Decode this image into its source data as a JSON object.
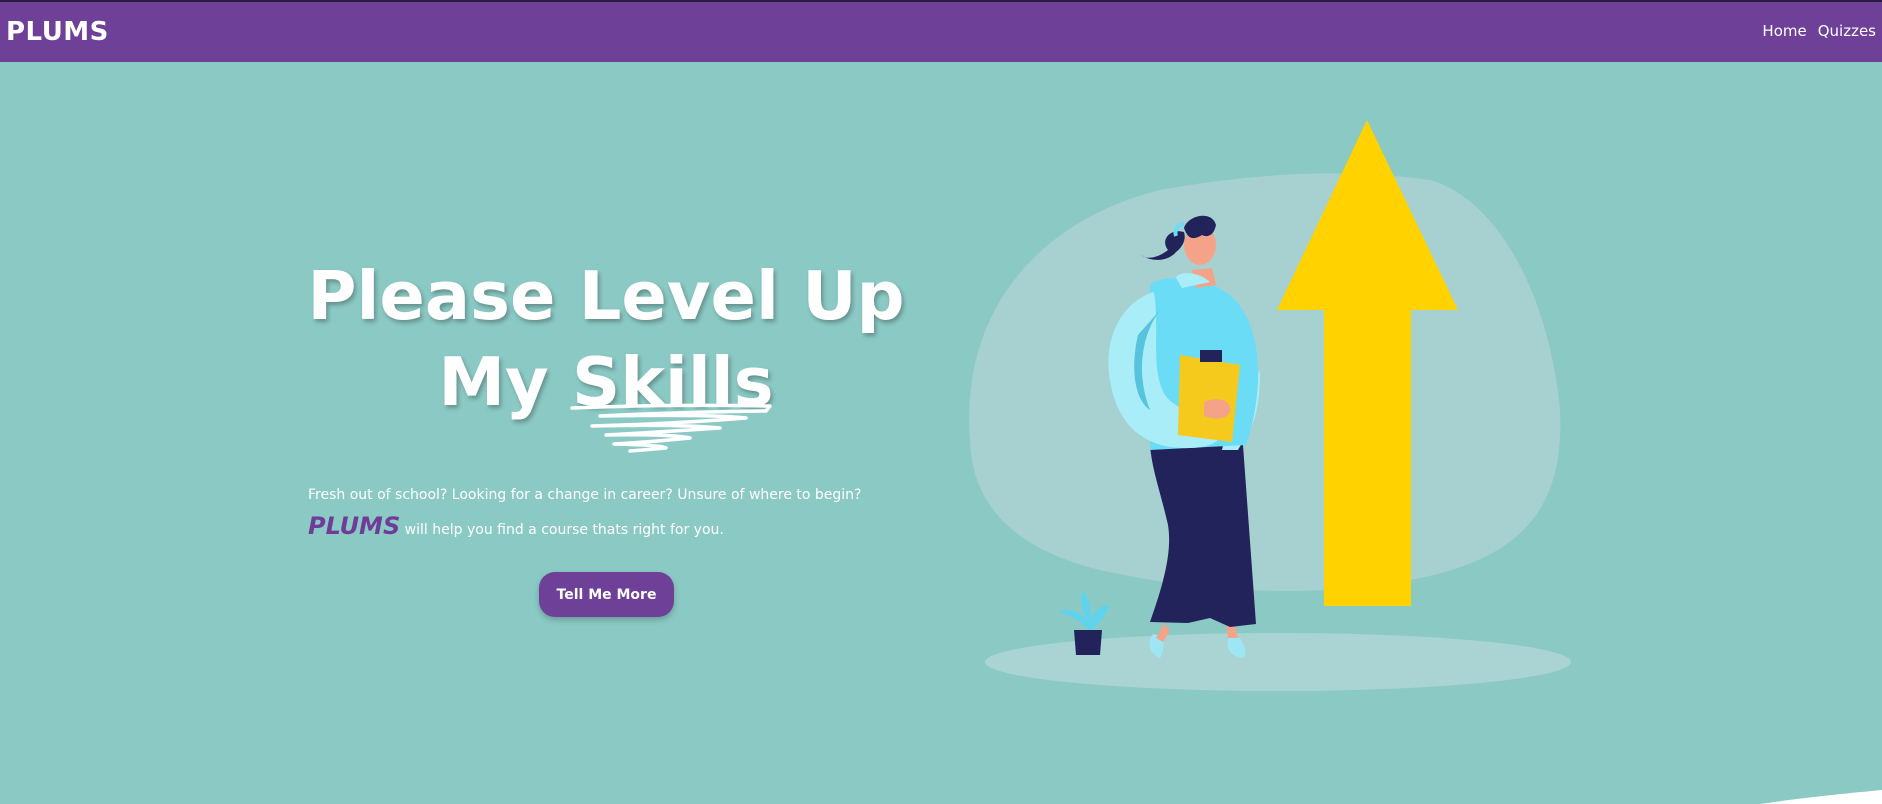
{
  "navbar": {
    "brand": "PLUMS",
    "links": [
      "Home",
      "Quizzes"
    ]
  },
  "hero": {
    "title_line1": "Please Level Up",
    "title_line2_prefix": "My ",
    "title_line2_emphasis": "Skills",
    "tagline_line1": "Fresh out of school? Looking for a change in career? Unsure of where to begin?",
    "tagline_brand": "PLUMS",
    "tagline_line2": " will help you find a course thats right for you.",
    "cta_label": "Tell Me More"
  },
  "colors": {
    "nav_background": "#6f4097",
    "page_background": "#8bc9c4",
    "accent_yellow": "#ffd200",
    "brand_text": "#6f3d99"
  }
}
